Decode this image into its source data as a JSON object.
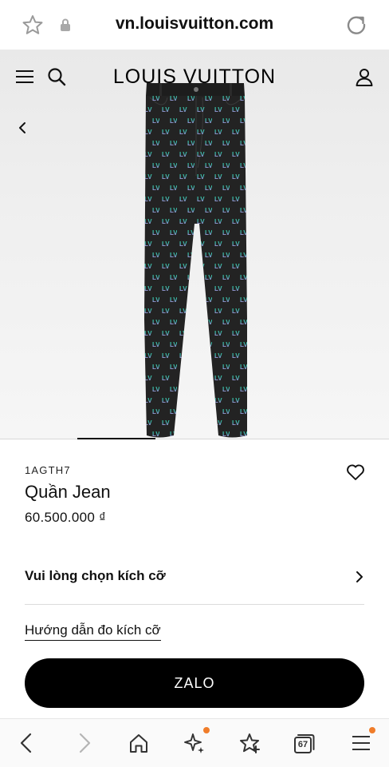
{
  "browser": {
    "url": "vn.louisvuitton.com",
    "icons": {
      "bookmark": "star-outline-icon",
      "secure": "lock-icon",
      "reload": "reload-icon"
    }
  },
  "header": {
    "brand": "LOUIS VUITTON",
    "icons": {
      "menu": "hamburger-menu-icon",
      "search": "search-icon",
      "account": "user-account-icon",
      "back": "chevron-left-icon"
    }
  },
  "gallery": {
    "product_image": "denim-jeans-monogram-image",
    "active_slide": 2,
    "slide_count": 5
  },
  "product": {
    "sku": "1AGTH7",
    "name": "Quần Jean",
    "price": "60.500.000 ₫",
    "wishlist_icon": "heart-outline-icon"
  },
  "size": {
    "select_label": "Vui lòng chọn kích cỡ",
    "guide_label": "Hướng dẫn đo kích cỡ"
  },
  "cta": {
    "label": "ZALO"
  },
  "bottom_bar": {
    "items": [
      "back-arrow-icon",
      "forward-arrow-icon",
      "home-icon",
      "ai-sparkle-icon",
      "favorites-star-icon",
      "tabs-icon",
      "menu-icon"
    ],
    "tab_count": "67",
    "notification_color": "#f07d2a"
  },
  "colors": {
    "accent_cta": "#000000",
    "notification_dot": "#f07d2a"
  }
}
